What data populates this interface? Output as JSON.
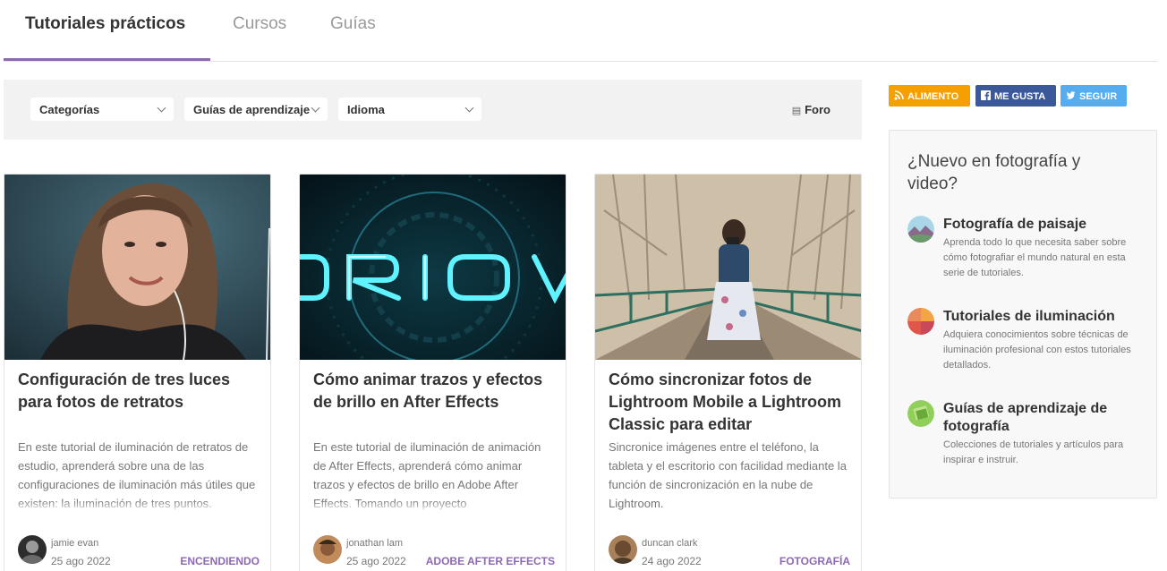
{
  "tabs": [
    {
      "label": "Tutoriales prácticos",
      "active": true
    },
    {
      "label": "Cursos",
      "active": false
    },
    {
      "label": "Guías",
      "active": false
    }
  ],
  "filters": {
    "categories": "Categorías",
    "learning_guides": "Guías de aprendizaje",
    "language": "Idioma",
    "forum": "Foro"
  },
  "cards": [
    {
      "title": "Configuración de tres luces para fotos de retratos",
      "description": "En este tutorial de iluminación de retratos de estudio, aprenderá sobre una de las configuraciones de iluminación más útiles que existen: la iluminación de tres puntos.",
      "author": "jamie evan",
      "date": "25 ago 2022",
      "category": "ENCENDIENDO"
    },
    {
      "title": "Cómo animar trazos y efectos de brillo en After Effects",
      "description": "En este tutorial de iluminación de animación de After Effects, aprenderá cómo animar trazos y efectos de brillo en Adobe After Effects. Tomando un proyecto",
      "author": "jonathan lam",
      "date": "25 ago 2022",
      "category": "ADOBE AFTER EFFECTS"
    },
    {
      "title": "Cómo sincronizar fotos de Lightroom Mobile a Lightroom Classic para editar",
      "description": "Sincronice imágenes entre el teléfono, la tableta y el escritorio con facilidad mediante la función de sincronización en la nube de Lightroom.",
      "author": "duncan clark",
      "date": "24 ago 2022",
      "category": "FOTOGRAFÍA"
    }
  ],
  "social": {
    "feed": "ALIMENTO",
    "like": "ME GUSTA",
    "follow": "SEGUIR",
    "colors": {
      "feed": "#f5a000",
      "like": "#3b5998",
      "follow": "#55acee"
    }
  },
  "sidebar": {
    "title": "¿Nuevo en fotografía y video?",
    "items": [
      {
        "title": "Fotografía de paisaje",
        "description": "Aprenda todo lo que necesita saber sobre cómo fotografiar el mundo natural en esta serie de tutoriales."
      },
      {
        "title": "Tutoriales de iluminación",
        "description": "Adquiera conocimientos sobre técnicas de iluminación profesional con estos tutoriales detallados."
      },
      {
        "title": "Guías de aprendizaje de fotografía",
        "description": "Colecciones de tutoriales y artículos para inspirar e instruir."
      }
    ]
  },
  "accent_color": "#8c68b5"
}
